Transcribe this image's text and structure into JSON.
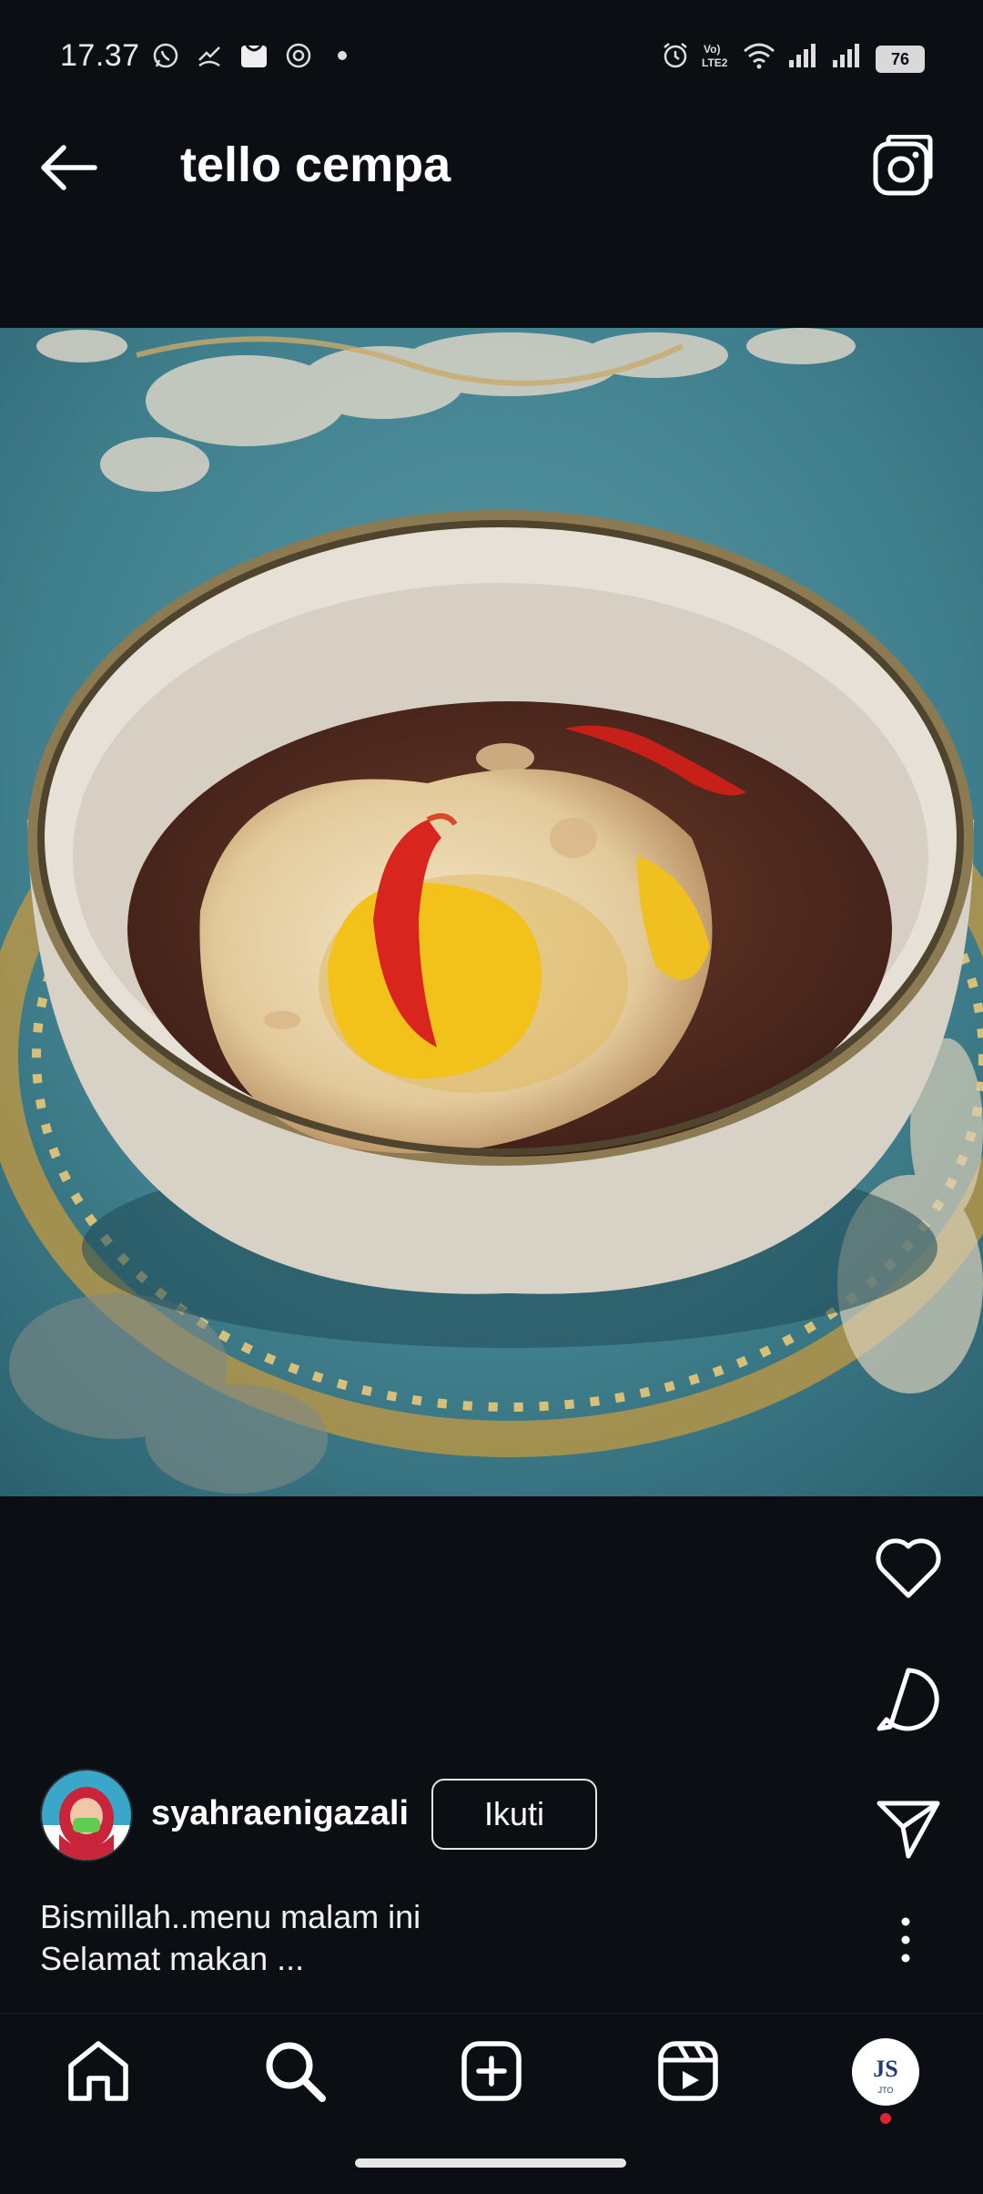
{
  "status_bar": {
    "time": "17.37",
    "battery": "76",
    "icons": [
      "whatsapp-icon",
      "missed-call-icon",
      "mail-icon",
      "sync-icon",
      "dot-icon",
      "alarm-icon",
      "volte-icon",
      "wifi-icon",
      "signal-icon",
      "signal-icon"
    ],
    "volte_label": "Vo)\nLTE2"
  },
  "header": {
    "title": "tello cempa",
    "back_icon": "arrow-left-icon",
    "camera_icon": "camera-icon"
  },
  "post": {
    "image_alt": "Bowl of soup with fried egg and red chili",
    "actions": [
      "heart-icon",
      "comment-icon",
      "send-icon"
    ],
    "user": {
      "username": "syahraenigazali",
      "follow_label": "Ikuti"
    },
    "caption_line1": "Bismillah..menu malam ini",
    "caption_line2": "Selamat makan ...",
    "more_icon": "more-vertical-icon"
  },
  "nav": {
    "items": [
      "home-icon",
      "search-icon",
      "create-icon",
      "reels-icon",
      "profile-icon"
    ],
    "profile_badge_color": "#e0242f"
  },
  "colors": {
    "background": "#0b0f14",
    "text": "#ffffff"
  }
}
